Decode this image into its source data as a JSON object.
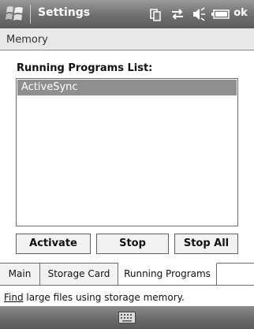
{
  "titlebar": {
    "title": "Settings",
    "ok_label": "ok"
  },
  "page": {
    "title": "Memory"
  },
  "running_programs": {
    "heading": "Running Programs List:",
    "items": [
      "ActiveSync"
    ],
    "selected_index": 0
  },
  "buttons": {
    "activate": "Activate",
    "stop": "Stop",
    "stop_all": "Stop All"
  },
  "tabs": {
    "main": "Main",
    "storage": "Storage Card",
    "running": "Running Programs"
  },
  "footer": {
    "link_word": "Find",
    "rest": " large files using storage memory."
  },
  "icons": [
    "windows-start-icon",
    "connectivity-icon",
    "sync-icon",
    "speaker-icon",
    "battery-icon",
    "keyboard-icon"
  ]
}
